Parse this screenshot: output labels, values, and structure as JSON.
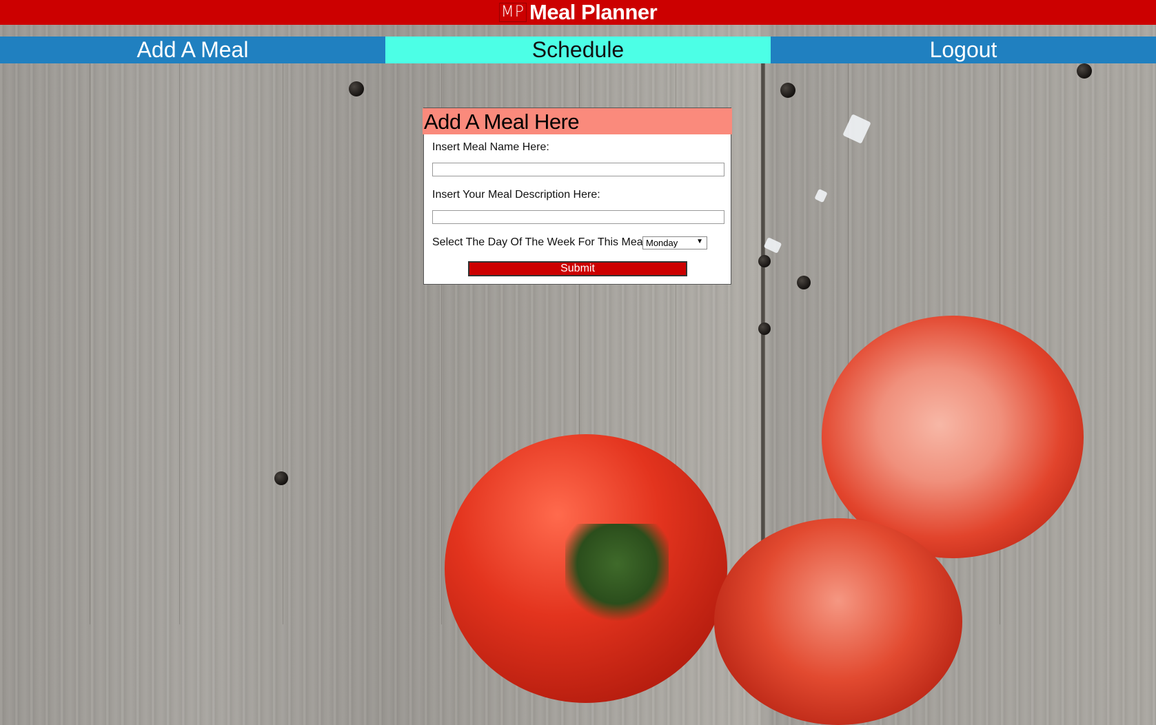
{
  "header": {
    "logo_mark": "MP",
    "brand": "Meal Planner",
    "color": "#cc0000"
  },
  "nav": {
    "items": [
      {
        "label": "Add A Meal",
        "active": false
      },
      {
        "label": "Schedule",
        "active": true
      },
      {
        "label": "Logout",
        "active": false
      }
    ],
    "color": "#2080c0",
    "active_color": "#4cffe6"
  },
  "form": {
    "title": "Add A Meal Here",
    "title_color": "#fa8a7c",
    "meal_name_label": "Insert Meal Name Here:",
    "meal_name_value": "",
    "description_label": "Insert Your Meal Description Here:",
    "description_value": "",
    "day_label": "Select The Day Of The Week For This Meal:",
    "day_selected": "Monday",
    "submit_label": "Submit"
  }
}
